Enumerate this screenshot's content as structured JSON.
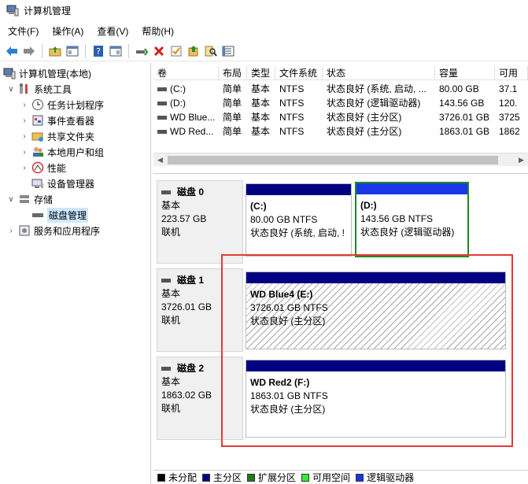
{
  "window": {
    "title": "计算机管理"
  },
  "menu": [
    "文件(F)",
    "操作(A)",
    "查看(V)",
    "帮助(H)"
  ],
  "toolbar": [
    "back-icon",
    "forward-icon",
    "up-folder-icon",
    "show-hide-tree-icon",
    "help-icon",
    "properties-icon",
    "connect-icon",
    "delete-icon",
    "check-icon",
    "export-icon",
    "search-icon",
    "settings-list-icon"
  ],
  "tree": {
    "root": "计算机管理(本地)",
    "items": [
      {
        "label": "系统工具",
        "level": 1,
        "expanded": true
      },
      {
        "label": "任务计划程序",
        "level": 2
      },
      {
        "label": "事件查看器",
        "level": 2
      },
      {
        "label": "共享文件夹",
        "level": 2
      },
      {
        "label": "本地用户和组",
        "level": 2
      },
      {
        "label": "性能",
        "level": 2
      },
      {
        "label": "设备管理器",
        "level": 2
      },
      {
        "label": "存储",
        "level": 1,
        "expanded": true
      },
      {
        "label": "磁盘管理",
        "level": 2,
        "selected": true
      },
      {
        "label": "服务和应用程序",
        "level": 1,
        "expanded": false
      }
    ]
  },
  "volumes": {
    "headers": [
      "卷",
      "布局",
      "类型",
      "文件系统",
      "状态",
      "容量",
      "可用"
    ],
    "rows": [
      [
        "(C:)",
        "简单",
        "基本",
        "NTFS",
        "状态良好 (系统, 启动, ...",
        "80.00 GB",
        "37.1"
      ],
      [
        "(D:)",
        "简单",
        "基本",
        "NTFS",
        "状态良好 (逻辑驱动器)",
        "143.56 GB",
        "120."
      ],
      [
        "WD Blue...",
        "简单",
        "基本",
        "NTFS",
        "状态良好 (主分区)",
        "3726.01 GB",
        "3725"
      ],
      [
        "WD Red...",
        "简单",
        "基本",
        "NTFS",
        "状态良好 (主分区)",
        "1863.01 GB",
        "1862"
      ]
    ]
  },
  "disks": [
    {
      "name": "磁盘 0",
      "type": "基本",
      "size": "223.57 GB",
      "status": "联机",
      "partitions": [
        {
          "name": "(C:)",
          "size": "80.00 GB NTFS",
          "status": "状态良好 (系统, 启动, !"
        },
        {
          "name": "(D:)",
          "size": "143.56 GB NTFS",
          "status": "状态良好 (逻辑驱动器)"
        }
      ]
    },
    {
      "name": "磁盘 1",
      "type": "基本",
      "size": "3726.01 GB",
      "status": "联机",
      "partitions": [
        {
          "name": "WD Blue4  (E:)",
          "size": "3726.01 GB NTFS",
          "status": "状态良好 (主分区)"
        }
      ]
    },
    {
      "name": "磁盘 2",
      "type": "基本",
      "size": "1863.02 GB",
      "status": "联机",
      "partitions": [
        {
          "name": "WD Red2  (F:)",
          "size": "1863.01 GB NTFS",
          "status": "状态良好 (主分区)"
        }
      ]
    }
  ],
  "legend": [
    {
      "label": "未分配",
      "color": "#000000"
    },
    {
      "label": "主分区",
      "color": "#000080"
    },
    {
      "label": "扩展分区",
      "color": "#1e7b1e"
    },
    {
      "label": "可用空间",
      "color": "#33ee33"
    },
    {
      "label": "逻辑驱动器",
      "color": "#1b36e6"
    }
  ],
  "colors": {
    "annotation_red": "#e53935",
    "selection_green": "#1e8a1e"
  }
}
